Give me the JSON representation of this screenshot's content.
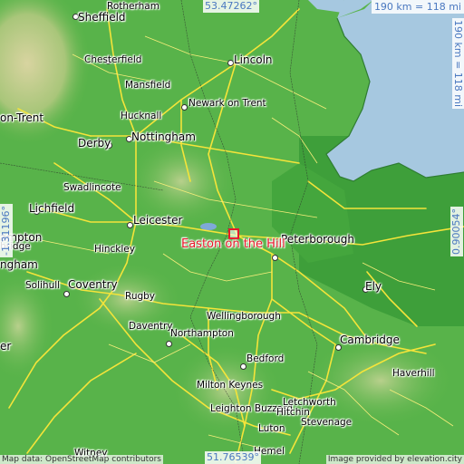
{
  "map": {
    "main_place": "Easton on the Hill",
    "scale_h": "190 km = 118 mi",
    "scale_v": "190 km = 118 mi",
    "coord_top": "53.47262°",
    "coord_bottom": "51.76539°",
    "coord_left": "-1.31196°",
    "coord_right": "0.90054°",
    "attribution": "Image provided by elevation.city",
    "attribution_left": "Map data: OpenStreetMap contributors",
    "colors": {
      "sea": "#a6c8e0",
      "lowland": "#49ac40",
      "highland": "#c9c78e",
      "roads": "#f4e43a",
      "marker": "#e8182a"
    }
  },
  "cities": [
    {
      "name": "Sheffield",
      "big": true
    },
    {
      "name": "Rotherham",
      "big": false
    },
    {
      "name": "Chesterfield",
      "big": false
    },
    {
      "name": "Mansfield",
      "big": false
    },
    {
      "name": "Lincoln",
      "big": true
    },
    {
      "name": "Newark on Trent",
      "big": false
    },
    {
      "name": "Hucknall",
      "big": false
    },
    {
      "name": "Nottingham",
      "big": true
    },
    {
      "name": "Derby",
      "big": true
    },
    {
      "name": "Swadlincote",
      "big": false
    },
    {
      "name": "Lichfield",
      "big": true
    },
    {
      "name": "Leicester",
      "big": true
    },
    {
      "name": "Hinckley",
      "big": false
    },
    {
      "name": "Coventry",
      "big": true
    },
    {
      "name": "Rugby",
      "big": false
    },
    {
      "name": "Solihull",
      "big": false
    },
    {
      "name": "Daventry",
      "big": false
    },
    {
      "name": "Northampton",
      "big": false
    },
    {
      "name": "Wellingborough",
      "big": false
    },
    {
      "name": "Peterborough",
      "big": true
    },
    {
      "name": "Ely",
      "big": true
    },
    {
      "name": "Cambridge",
      "big": true
    },
    {
      "name": "Haverhill",
      "big": false
    },
    {
      "name": "Bedford",
      "big": false
    },
    {
      "name": "Milton Keynes",
      "big": false
    },
    {
      "name": "Leighton Buzzard",
      "big": false
    },
    {
      "name": "Luton",
      "big": false
    },
    {
      "name": "Letchworth",
      "big": false
    },
    {
      "name": "Hitchin",
      "big": false
    },
    {
      "name": "Stevenage",
      "big": false
    },
    {
      "name": "on-Trent",
      "big": true
    },
    {
      "name": "ampton",
      "big": true
    },
    {
      "name": "bridge",
      "big": false
    },
    {
      "name": "ngham",
      "big": true
    },
    {
      "name": "er",
      "big": true
    },
    {
      "name": "Witney",
      "big": false
    },
    {
      "name": "Hemel",
      "big": false
    }
  ]
}
